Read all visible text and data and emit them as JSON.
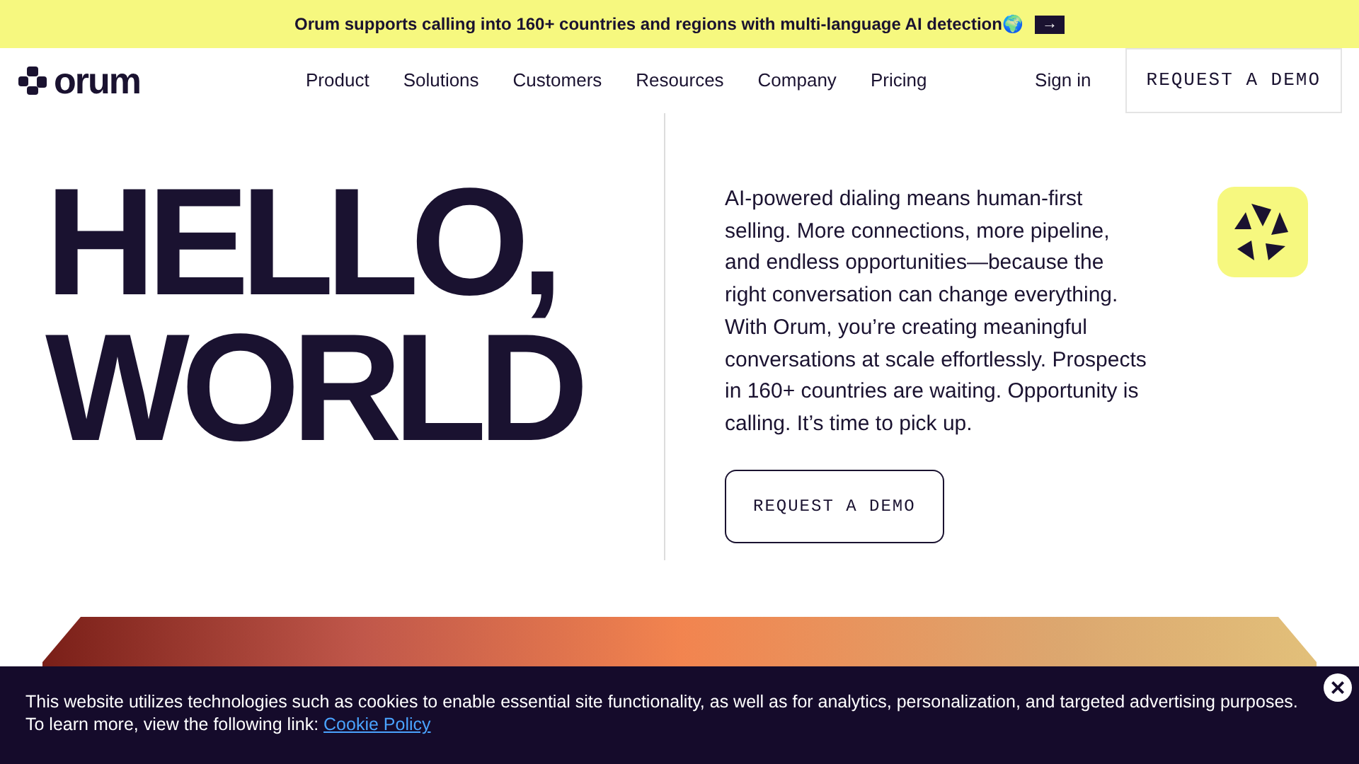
{
  "announcement": {
    "text": "Orum supports calling into 160+ countries and regions with multi-language AI detection🌍",
    "arrow": "→"
  },
  "nav": {
    "logo": "orum",
    "items": [
      "Product",
      "Solutions",
      "Customers",
      "Resources",
      "Company",
      "Pricing"
    ],
    "sign_in": "Sign in",
    "cta": "REQUEST A DEMO"
  },
  "hero": {
    "headline": [
      "HELLO,",
      "WORLD"
    ],
    "body": "AI-powered dialing means human-first selling. More connections, more pipeline, and endless opportunities—because the right conversation can change everything. With Orum, you’re creating meaningful conversations at scale effortlessly. Prospects in 160+ countries are waiting. Opportunity is calling. It’s time to pick up.",
    "cta": "REQUEST A DEMO"
  },
  "cookie_banner": {
    "text": "This website utilizes technologies such as cookies to enable essential site functionality, as well as for analytics, personalization, and targeted advertising purposes. To learn more, view the following link: ",
    "link": "Cookie Policy",
    "close": "×"
  }
}
